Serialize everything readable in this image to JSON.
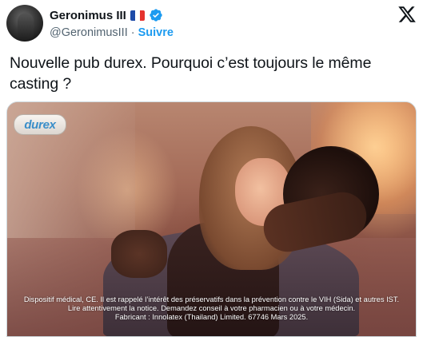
{
  "author": {
    "display_name": "Geronimus III",
    "handle": "@GeronimusIII",
    "separator": "·",
    "follow_label": "Suivre",
    "flag_icon": "france-flag-icon",
    "verified_icon": "verified-badge-icon",
    "verified_color": "#1d9bf0"
  },
  "platform": {
    "logo_icon": "x-logo-icon"
  },
  "tweet": {
    "text": "Nouvelle pub durex. Pourquoi c’est toujours le même casting ?"
  },
  "media": {
    "brand_logo": "durex",
    "disclaimer_lines": [
      "Dispositif médical, CE. Il est rappelé l’intérêt des préservatifs dans la prévention contre le VIH (Sida) et autres IST.",
      "Lire attentivement la notice. Demandez conseil à votre pharmacien ou à votre médecin.",
      "Fabricant : Innolatex (Thailand) Limited. 67746 Mars 2025."
    ]
  },
  "colors": {
    "accent": "#1d9bf0",
    "text_primary": "#0f1419",
    "text_secondary": "#536471",
    "brand_durex": "#3a8ec9"
  }
}
